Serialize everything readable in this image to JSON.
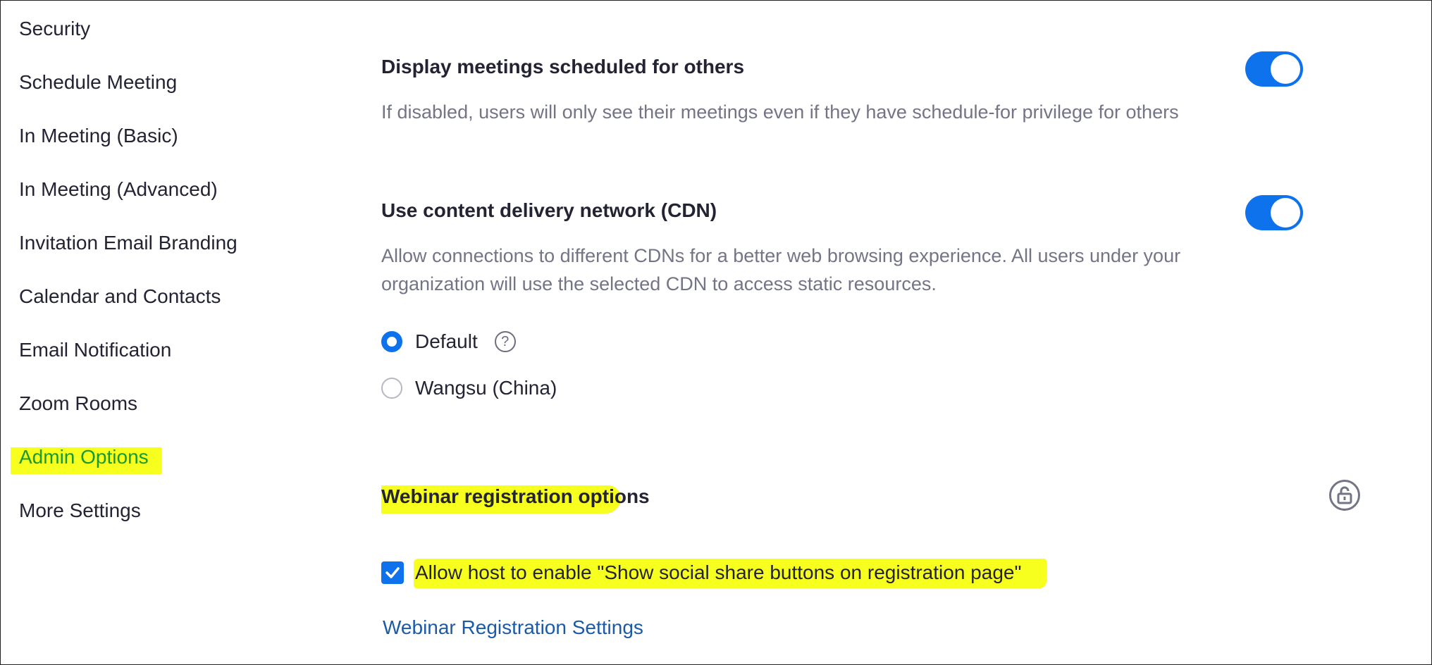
{
  "sidebar": {
    "items": [
      {
        "label": "Security"
      },
      {
        "label": "Schedule Meeting"
      },
      {
        "label": "In Meeting (Basic)"
      },
      {
        "label": "In Meeting (Advanced)"
      },
      {
        "label": "Invitation Email Branding"
      },
      {
        "label": "Calendar and Contacts"
      },
      {
        "label": "Email Notification"
      },
      {
        "label": "Zoom Rooms"
      },
      {
        "label": "Admin Options",
        "highlighted": true
      },
      {
        "label": "More Settings"
      }
    ]
  },
  "settings": {
    "display_meetings": {
      "title": "Display meetings scheduled for others",
      "description": "If disabled, users will only see their meetings even if they have schedule-for privilege for others",
      "enabled": true
    },
    "cdn": {
      "title": "Use content delivery network (CDN)",
      "description": "Allow connections to different CDNs for a better web browsing experience. All users under your organization will use the selected CDN to access static resources.",
      "enabled": true,
      "options": [
        {
          "label": "Default",
          "selected": true,
          "help_icon": "question-icon"
        },
        {
          "label": "Wangsu (China)",
          "selected": false
        }
      ]
    },
    "webinar_registration": {
      "title": "Webinar registration options",
      "lock_icon": "unlock-icon",
      "checkbox_label": "Allow host to enable \"Show social share buttons on registration page\"",
      "checked": true,
      "link_label": "Webinar Registration Settings"
    }
  },
  "colors": {
    "accent": "#0e72ed",
    "highlight": "#f7ff1e",
    "link": "#1c5aa6",
    "muted_text": "#747487"
  }
}
